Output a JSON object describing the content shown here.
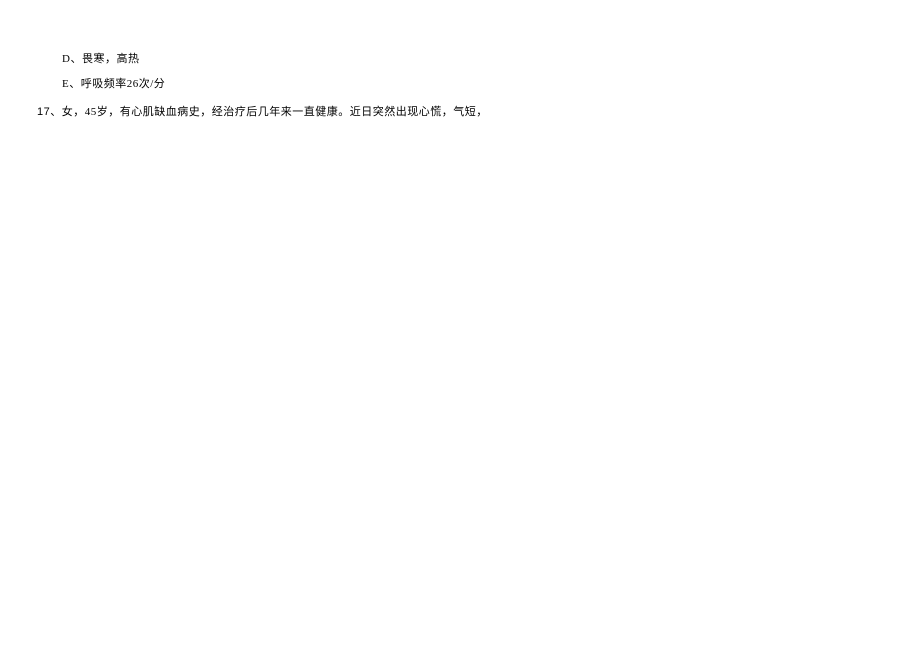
{
  "options": {
    "d": "D、畏寒，高热",
    "e": "E、呼吸频率26次/分"
  },
  "question": {
    "number": "17",
    "text": "、女，45岁，有心肌缺血病史，经治疗后几年来一直健康。近日突然出现心慌，气短，"
  }
}
